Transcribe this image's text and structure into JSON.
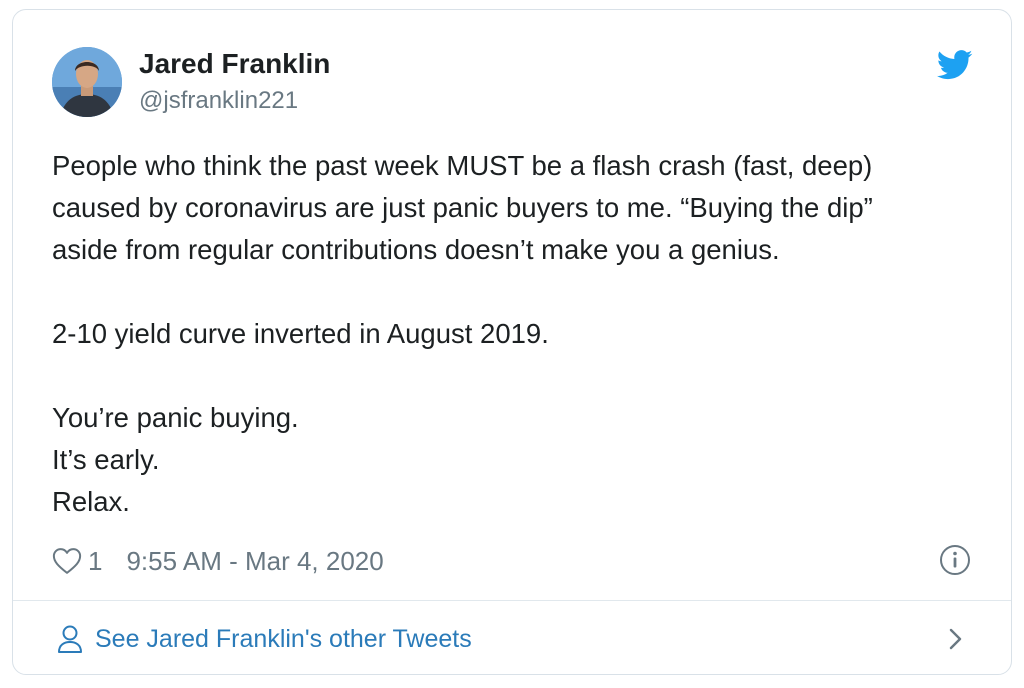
{
  "tweet": {
    "author": {
      "name": "Jared Franklin",
      "handle": "@jsfranklin221"
    },
    "paragraphs": [
      [
        "People who think the past week MUST be a flash crash (fast, deep)",
        "caused by coronavirus are just panic buyers to me. “Buying the dip”",
        "aside from regular contributions doesn’t make you a genius."
      ],
      [
        "2-10 yield curve inverted in August 2019."
      ],
      [
        "You’re panic buying.",
        "It’s early.",
        "Relax."
      ]
    ],
    "like_count": "1",
    "timestamp": "9:55 AM - Mar 4, 2020",
    "footer_link": "See Jared Franklin's other Tweets"
  },
  "colors": {
    "brand_blue": "#1da1f2",
    "link_blue": "#2b7bb9",
    "secondary_text": "#697882",
    "primary_text": "#1c2022",
    "border": "#d9e1e8"
  },
  "icons": {
    "brand": "twitter-bird-icon",
    "like": "heart-icon",
    "info": "info-icon",
    "profile": "person-icon",
    "navigate": "chevron-right-icon"
  }
}
